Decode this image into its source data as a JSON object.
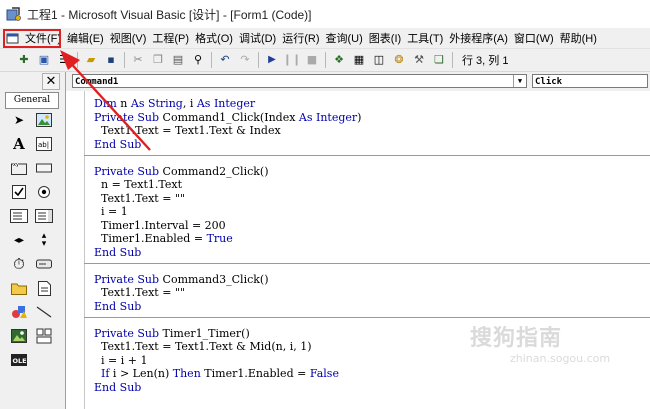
{
  "window": {
    "title": "工程1 - Microsoft Visual Basic [设计] - [Form1 (Code)]"
  },
  "menu": {
    "items": [
      "文件(F)",
      "编辑(E)",
      "视图(V)",
      "工程(P)",
      "格式(O)",
      "调试(D)",
      "运行(R)",
      "查询(U)",
      "图表(I)",
      "工具(T)",
      "外接程序(A)",
      "窗口(W)",
      "帮助(H)"
    ],
    "highlighted": "文件(F)"
  },
  "toolbar": {
    "position_text": "行 3, 列 1"
  },
  "toolbox": {
    "close_glyph": "✕",
    "tab_label": "General"
  },
  "editor": {
    "object_combo": "Command1",
    "procedure_combo": "Click",
    "blocks": [
      [
        "Dim n As String, i As Integer",
        "Private Sub Command1_Click(Index As Integer)",
        "  Text1.Text = Text1.Text & Index",
        "End Sub"
      ],
      [
        "Private Sub Command2_Click()",
        "  n = Text1.Text",
        "  Text1.Text = \"\"",
        "  i = 1",
        "  Timer1.Interval = 200",
        "  Timer1.Enabled = True",
        "End Sub"
      ],
      [
        "Private Sub Command3_Click()",
        "  Text1.Text = \"\"",
        "End Sub"
      ],
      [
        "Private Sub Timer1_Timer()",
        "  Text1.Text = Text1.Text & Mid(n, i, 1)",
        "  i = i + 1",
        "  If i > Len(n) Then Timer1.Enabled = False",
        "End Sub"
      ]
    ]
  },
  "colors": {
    "keyword": "#0000aa",
    "annotation": "#e02020"
  },
  "watermark": {
    "line1": "搜狗指南",
    "line2": "zhinan.sogou.com"
  }
}
